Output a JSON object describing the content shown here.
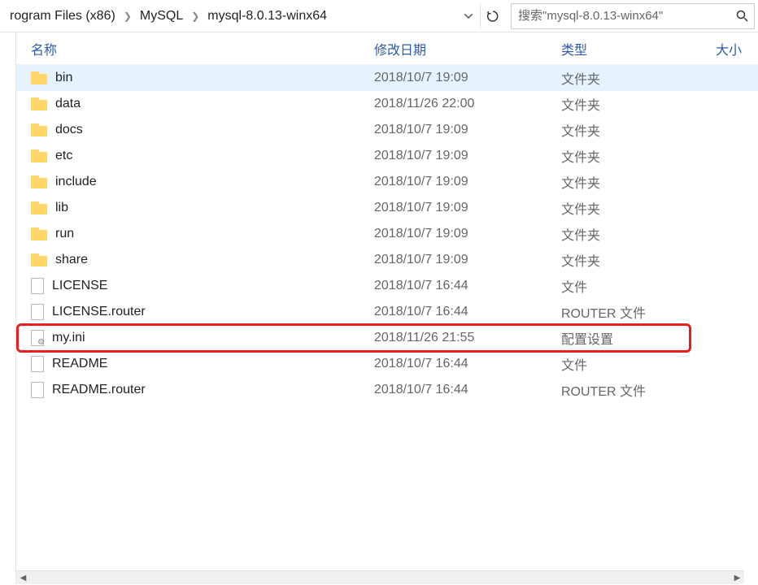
{
  "breadcrumb": {
    "item0": "rogram Files (x86)",
    "item1": "MySQL",
    "item2": "mysql-8.0.13-winx64"
  },
  "search": {
    "placeholder": "搜索\"mysql-8.0.13-winx64\""
  },
  "columns": {
    "name": "名称",
    "date": "修改日期",
    "type": "类型",
    "size": "大小"
  },
  "files": [
    {
      "name": "bin",
      "date": "2018/10/7 19:09",
      "type": "文件夹",
      "icon": "folder",
      "selected": true
    },
    {
      "name": "data",
      "date": "2018/11/26 22:00",
      "type": "文件夹",
      "icon": "folder"
    },
    {
      "name": "docs",
      "date": "2018/10/7 19:09",
      "type": "文件夹",
      "icon": "folder"
    },
    {
      "name": "etc",
      "date": "2018/10/7 19:09",
      "type": "文件夹",
      "icon": "folder"
    },
    {
      "name": "include",
      "date": "2018/10/7 19:09",
      "type": "文件夹",
      "icon": "folder"
    },
    {
      "name": "lib",
      "date": "2018/10/7 19:09",
      "type": "文件夹",
      "icon": "folder"
    },
    {
      "name": "run",
      "date": "2018/10/7 19:09",
      "type": "文件夹",
      "icon": "folder"
    },
    {
      "name": "share",
      "date": "2018/10/7 19:09",
      "type": "文件夹",
      "icon": "folder"
    },
    {
      "name": "LICENSE",
      "date": "2018/10/7 16:44",
      "type": "文件",
      "icon": "file"
    },
    {
      "name": "LICENSE.router",
      "date": "2018/10/7 16:44",
      "type": "ROUTER 文件",
      "icon": "file"
    },
    {
      "name": "my.ini",
      "date": "2018/11/26 21:55",
      "type": "配置设置",
      "icon": "ini",
      "highlighted": true
    },
    {
      "name": "README",
      "date": "2018/10/7 16:44",
      "type": "文件",
      "icon": "file"
    },
    {
      "name": "README.router",
      "date": "2018/10/7 16:44",
      "type": "ROUTER 文件",
      "icon": "file"
    }
  ]
}
